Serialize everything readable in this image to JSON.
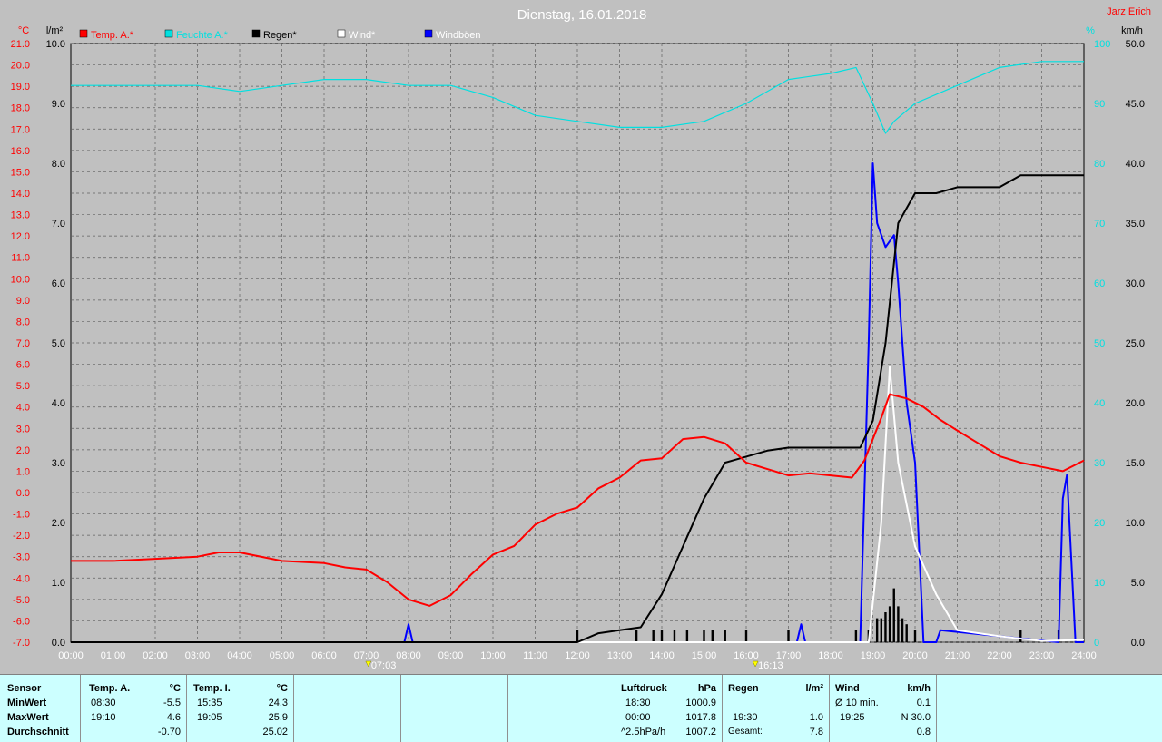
{
  "title": "Dienstag, 16.01.2018",
  "author": "Jarz Erich",
  "axes": {
    "left_unit": "°C",
    "left2_unit": "l/m²",
    "right_unit": "%",
    "right2_unit": "km/h",
    "temp_ticks": [
      "21.0",
      "20.0",
      "19.0",
      "18.0",
      "17.0",
      "16.0",
      "15.0",
      "14.0",
      "13.0",
      "12.0",
      "11.0",
      "10.0",
      "9.0",
      "8.0",
      "7.0",
      "6.0",
      "5.0",
      "4.0",
      "3.0",
      "2.0",
      "1.0",
      "0.0",
      "-1.0",
      "-2.0",
      "-3.0",
      "-4.0",
      "-5.0",
      "-6.0",
      "-7.0"
    ],
    "rain_ticks": [
      "10.0",
      "9.0",
      "8.0",
      "7.0",
      "6.0",
      "5.0",
      "4.0",
      "3.0",
      "2.0",
      "1.0",
      "0.0"
    ],
    "hum_ticks": [
      "100",
      "90",
      "80",
      "70",
      "60",
      "50",
      "40",
      "30",
      "20",
      "10",
      "0"
    ],
    "wind_ticks": [
      "50.0",
      "45.0",
      "40.0",
      "35.0",
      "30.0",
      "25.0",
      "20.0",
      "15.0",
      "10.0",
      "5.0",
      "0.0"
    ],
    "time_ticks": [
      "00:00",
      "01:00",
      "02:00",
      "03:00",
      "04:00",
      "05:00",
      "06:00",
      "07:00",
      "08:00",
      "09:00",
      "10:00",
      "11:00",
      "12:00",
      "13:00",
      "14:00",
      "15:00",
      "16:00",
      "17:00",
      "18:00",
      "19:00",
      "20:00",
      "21:00",
      "22:00",
      "23:00",
      "24:00"
    ],
    "sunrise": "07:03",
    "sunset": "16:13"
  },
  "colors": {
    "temp": "#ff0000",
    "humidity": "#00e0e0",
    "rain": "#000000",
    "wind": "#ffffff",
    "gust": "#0000ff",
    "background": "#c0c0c0",
    "table": "#ccffff"
  },
  "chart_data": {
    "type": "line",
    "title": "Dienstag, 16.01.2018",
    "x_unit": "hours",
    "xlim": [
      0,
      24
    ],
    "legend_position": "top",
    "series": [
      {
        "name": "Temp. A.*",
        "axis": "temp",
        "ylim": [
          -7,
          21
        ],
        "x": [
          0,
          1,
          2,
          3,
          3.5,
          4,
          5,
          6,
          6.5,
          7,
          7.5,
          8,
          8.5,
          9,
          9.5,
          10,
          10.5,
          11,
          11.5,
          12,
          12.5,
          13,
          13.5,
          14,
          14.5,
          15,
          15.5,
          16,
          16.5,
          17,
          17.5,
          18,
          18.5,
          18.8,
          19.2,
          19.4,
          19.8,
          20.2,
          20.6,
          21,
          21.5,
          22,
          22.5,
          23,
          23.5,
          24
        ],
        "y": [
          -3.2,
          -3.2,
          -3.1,
          -3.0,
          -2.8,
          -2.8,
          -3.2,
          -3.3,
          -3.5,
          -3.6,
          -4.2,
          -5.0,
          -5.3,
          -4.8,
          -3.8,
          -2.9,
          -2.5,
          -1.5,
          -1.0,
          -0.7,
          0.2,
          0.7,
          1.5,
          1.6,
          2.5,
          2.6,
          2.3,
          1.4,
          1.1,
          0.8,
          0.9,
          0.8,
          0.7,
          1.5,
          3.5,
          4.6,
          4.4,
          4.0,
          3.4,
          2.9,
          2.3,
          1.7,
          1.4,
          1.2,
          1.0,
          1.5
        ]
      },
      {
        "name": "Feuchte A.*",
        "axis": "humidity",
        "ylim": [
          0,
          100
        ],
        "x": [
          0,
          3,
          4,
          5,
          6,
          7,
          8,
          9,
          10,
          11,
          12,
          13,
          14,
          15,
          16,
          17,
          18,
          18.6,
          19,
          19.3,
          19.5,
          20,
          21,
          22,
          23,
          24
        ],
        "y": [
          93,
          93,
          92,
          93,
          94,
          94,
          93,
          93,
          91,
          88,
          87,
          86,
          86,
          87,
          90,
          94,
          95,
          96,
          90,
          85,
          87,
          90,
          93,
          96,
          97,
          97
        ]
      },
      {
        "name": "Regen*",
        "axis": "rain",
        "ylim": [
          0,
          10
        ],
        "x": [
          0,
          12,
          12.5,
          13,
          13.5,
          14,
          14.5,
          15,
          15.5,
          16,
          16.5,
          17,
          18,
          18.7,
          19,
          19.3,
          19.6,
          20,
          20.5,
          21,
          22,
          22.5,
          23,
          24
        ],
        "y": [
          0,
          0,
          0.15,
          0.2,
          0.25,
          0.8,
          1.6,
          2.4,
          3.0,
          3.1,
          3.2,
          3.25,
          3.25,
          3.25,
          3.7,
          5.0,
          7.0,
          7.5,
          7.5,
          7.6,
          7.6,
          7.8,
          7.8,
          7.8
        ]
      },
      {
        "name": "Wind*",
        "axis": "wind",
        "ylim": [
          0,
          50
        ],
        "x": [
          0,
          18.9,
          19.2,
          19.4,
          19.6,
          20,
          20.5,
          21,
          22,
          23,
          24
        ],
        "y": [
          0,
          0,
          10,
          23,
          15,
          8,
          4,
          1,
          0.5,
          0.1,
          0.2
        ]
      },
      {
        "name": "Windböen",
        "axis": "wind",
        "ylim": [
          0,
          50
        ],
        "x": [
          0,
          7.9,
          8,
          8.1,
          17.2,
          17.3,
          17.4,
          18.7,
          18.9,
          19,
          19.1,
          19.3,
          19.5,
          19.6,
          19.8,
          20,
          20.2,
          20.5,
          20.6,
          23.4,
          23.5,
          23.6,
          23.8,
          24
        ],
        "y": [
          0,
          0,
          1.5,
          0,
          0,
          1.5,
          0,
          0,
          25,
          40,
          35,
          33,
          34,
          30,
          20,
          15,
          0,
          0,
          1.0,
          0,
          12,
          14,
          0,
          0
        ]
      }
    ],
    "rain_bars": {
      "unit": "l/m²",
      "x": [
        12.0,
        13.4,
        13.8,
        14.0,
        14.3,
        14.6,
        15.0,
        15.2,
        15.5,
        16.0,
        17.0,
        18.6,
        18.9,
        19.1,
        19.2,
        19.3,
        19.4,
        19.5,
        19.6,
        19.7,
        19.8,
        20.0,
        22.5,
        23.4
      ],
      "y": [
        0.2,
        0.2,
        0.2,
        0.2,
        0.2,
        0.2,
        0.2,
        0.2,
        0.2,
        0.2,
        0.2,
        0.2,
        0.2,
        0.4,
        0.4,
        0.5,
        0.6,
        0.9,
        0.6,
        0.4,
        0.3,
        0.2,
        0.2,
        0.2
      ]
    }
  },
  "table": {
    "col_sensor": {
      "header": "Sensor",
      "rows": [
        "MinWert",
        "MaxWert",
        "Durchschnitt"
      ]
    },
    "col_temp_a": {
      "header": "Temp. A.",
      "unit": "°C",
      "times": [
        "08:30",
        "19:10",
        ""
      ],
      "values": [
        "-5.5",
        "4.6",
        "-0.70"
      ]
    },
    "col_temp_i": {
      "header": "Temp. I.",
      "unit": "°C",
      "times": [
        "15:35",
        "19:05",
        ""
      ],
      "values": [
        "24.3",
        "25.9",
        "25.02"
      ]
    },
    "col_pressure": {
      "header": "Luftdruck",
      "unit": "hPa",
      "times": [
        "18:30",
        "00:00",
        "^2.5hPa/h"
      ],
      "values": [
        "1000.9",
        "1017.8",
        "1007.2"
      ]
    },
    "col_rain": {
      "header": "Regen",
      "unit": "l/m²",
      "times": [
        "",
        "19:30",
        "Gesamt:"
      ],
      "values": [
        "",
        "1.0",
        "7.8"
      ]
    },
    "col_wind": {
      "header": "Wind",
      "unit": "km/h",
      "times": [
        "Ø 10 min.",
        "19:25",
        ""
      ],
      "values": [
        "0.1",
        "N 30.0",
        "0.8"
      ]
    }
  }
}
